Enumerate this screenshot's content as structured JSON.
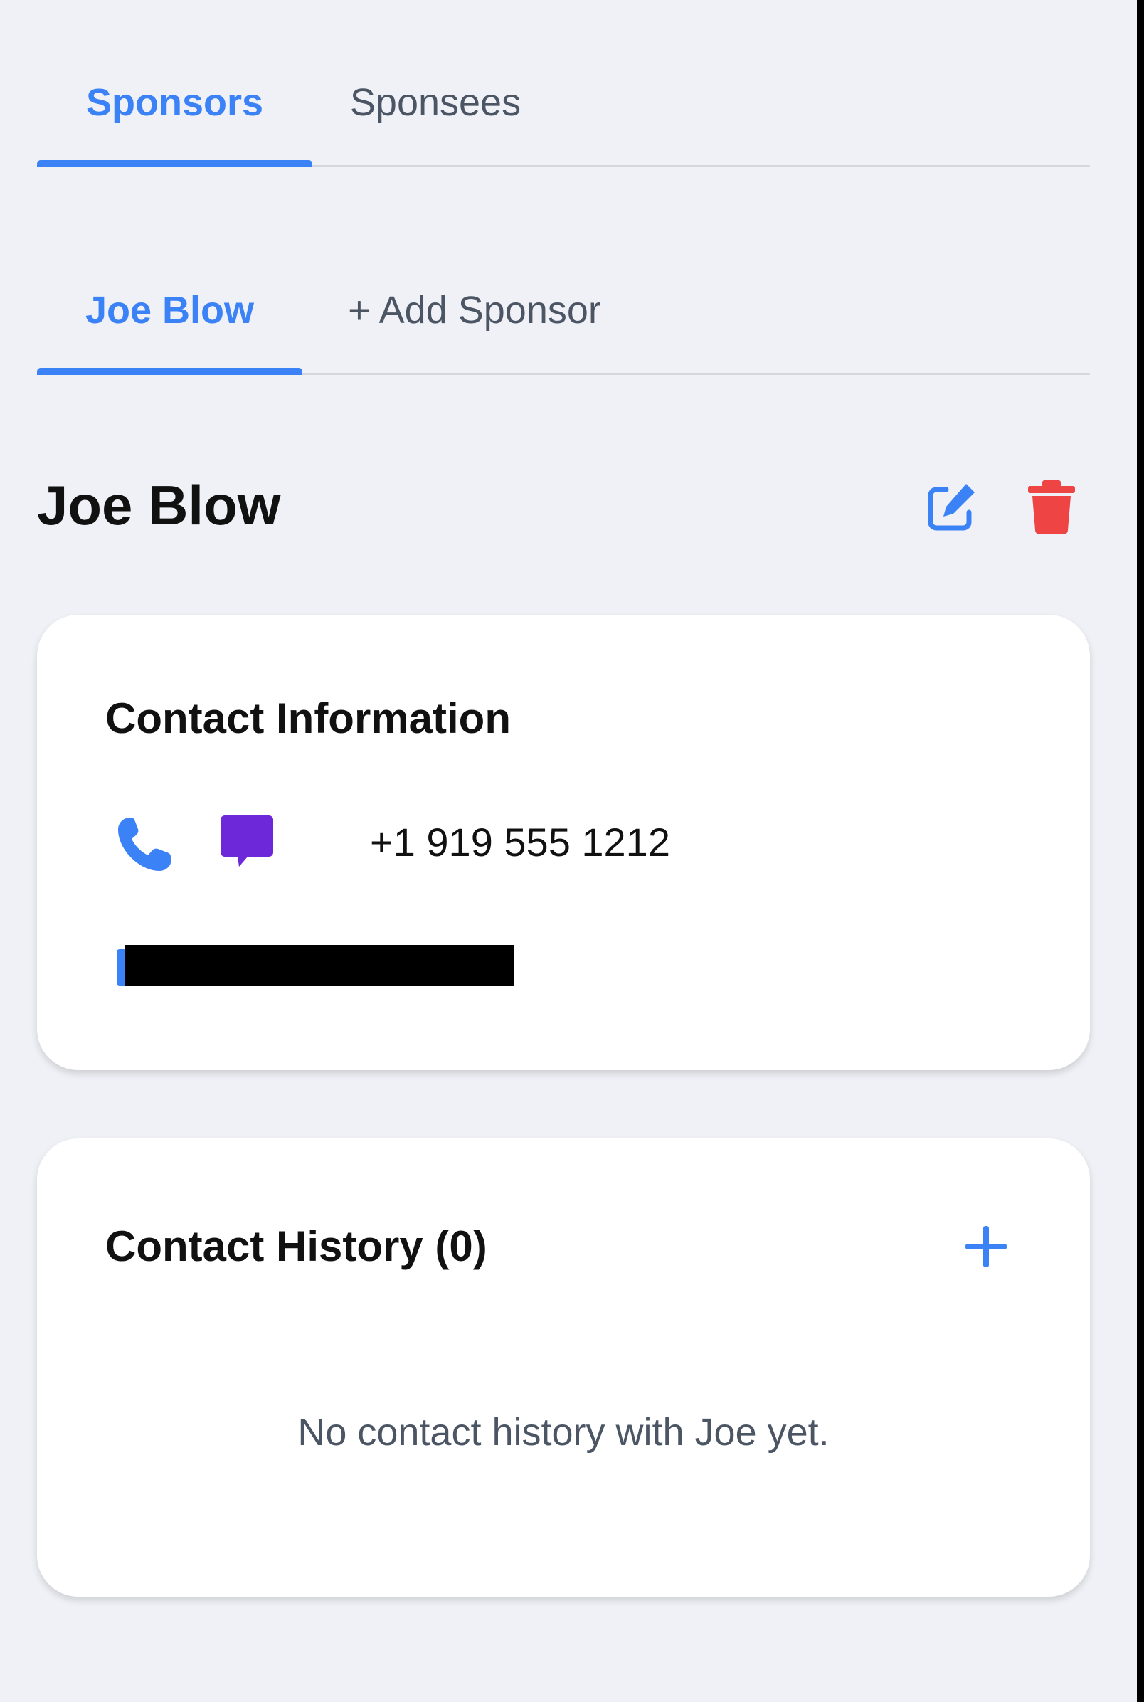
{
  "tabs": {
    "primary": [
      {
        "label": "Sponsors",
        "active": true
      },
      {
        "label": "Sponsees",
        "active": false
      }
    ],
    "secondary": [
      {
        "label": "Joe Blow",
        "active": true
      },
      {
        "label": "+ Add Sponsor",
        "active": false
      }
    ]
  },
  "person": {
    "name": "Joe Blow",
    "actions": {
      "edit_icon": "edit-icon",
      "delete_icon": "trash-icon"
    }
  },
  "contact_info": {
    "title": "Contact Information",
    "phone": "+1 919 555 1212",
    "phone_icon": "phone-icon",
    "message_icon": "chat-bubble-icon",
    "email_redacted": true
  },
  "contact_history": {
    "title": "Contact History (0)",
    "empty_message": "No contact history with Joe yet.",
    "add_icon": "plus-icon"
  },
  "colors": {
    "background": "#eff1f6",
    "accent": "#3b82f6",
    "danger": "#ef4444",
    "message": "#6d28d9",
    "muted_text": "#4b5563"
  }
}
